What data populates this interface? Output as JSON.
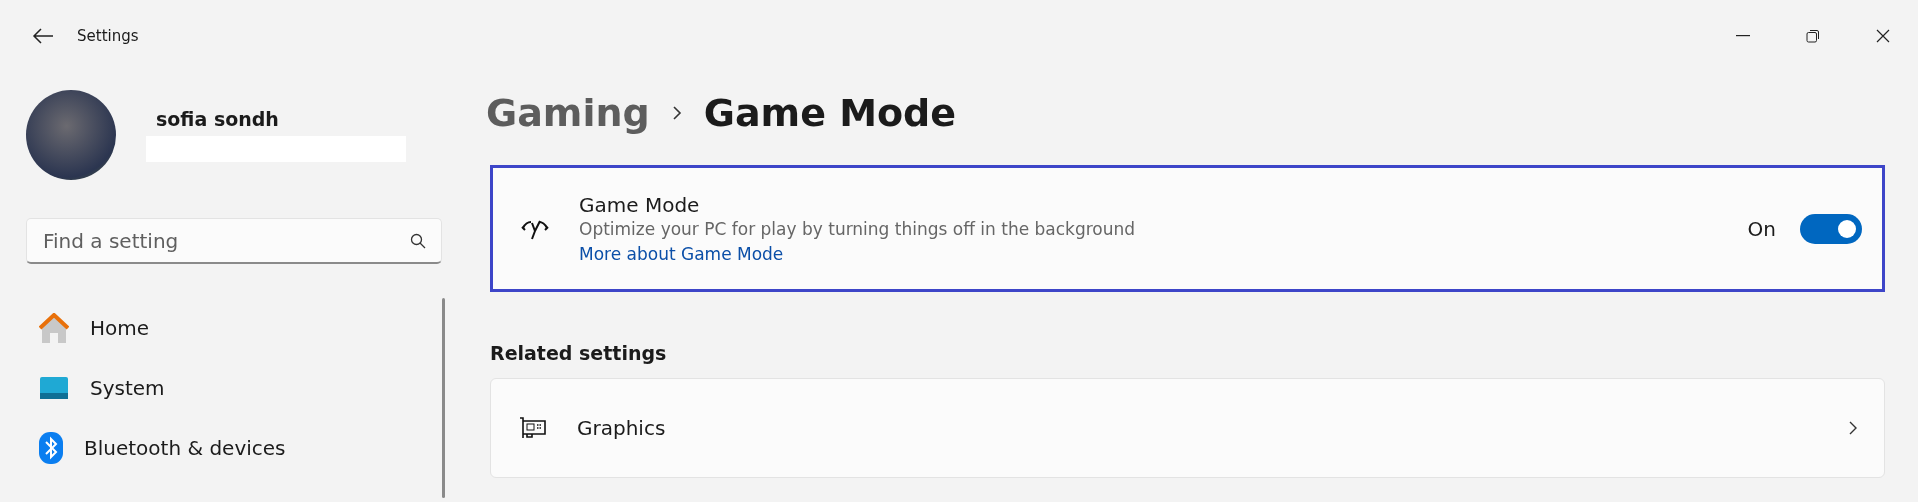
{
  "window": {
    "title": "Settings"
  },
  "account": {
    "name": "sofia sondh"
  },
  "search": {
    "placeholder": "Find a setting"
  },
  "sidebar": {
    "items": [
      {
        "label": "Home",
        "kind": "home"
      },
      {
        "label": "System",
        "kind": "system"
      },
      {
        "label": "Bluetooth & devices",
        "kind": "bluetooth"
      }
    ]
  },
  "breadcrumb": {
    "parent": "Gaming",
    "current": "Game Mode"
  },
  "game_mode": {
    "title": "Game Mode",
    "description": "Optimize your PC for play by turning things off in the background",
    "link": "More about Game Mode",
    "state_label": "On",
    "on": true
  },
  "related": {
    "heading": "Related settings",
    "items": [
      {
        "label": "Graphics"
      }
    ]
  }
}
